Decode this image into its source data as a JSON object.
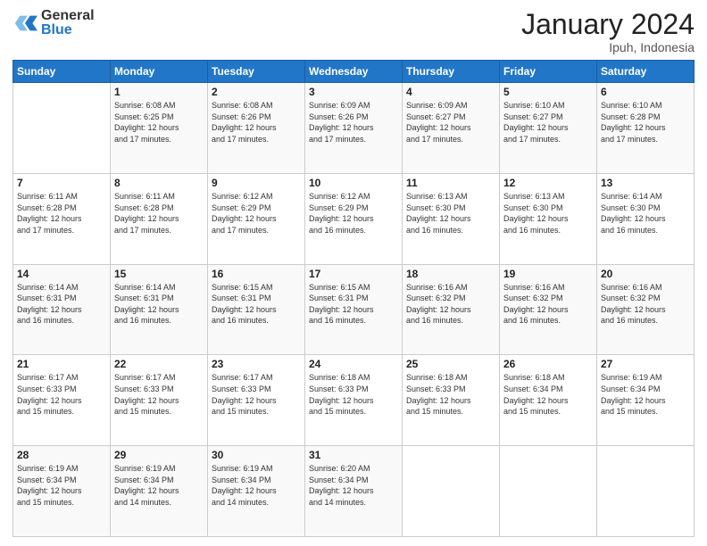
{
  "header": {
    "logo_general": "General",
    "logo_blue": "Blue",
    "month_title": "January 2024",
    "location": "Ipuh, Indonesia"
  },
  "days_of_week": [
    "Sunday",
    "Monday",
    "Tuesday",
    "Wednesday",
    "Thursday",
    "Friday",
    "Saturday"
  ],
  "weeks": [
    [
      {
        "day": "",
        "info": ""
      },
      {
        "day": "1",
        "info": "Sunrise: 6:08 AM\nSunset: 6:25 PM\nDaylight: 12 hours\nand 17 minutes."
      },
      {
        "day": "2",
        "info": "Sunrise: 6:08 AM\nSunset: 6:26 PM\nDaylight: 12 hours\nand 17 minutes."
      },
      {
        "day": "3",
        "info": "Sunrise: 6:09 AM\nSunset: 6:26 PM\nDaylight: 12 hours\nand 17 minutes."
      },
      {
        "day": "4",
        "info": "Sunrise: 6:09 AM\nSunset: 6:27 PM\nDaylight: 12 hours\nand 17 minutes."
      },
      {
        "day": "5",
        "info": "Sunrise: 6:10 AM\nSunset: 6:27 PM\nDaylight: 12 hours\nand 17 minutes."
      },
      {
        "day": "6",
        "info": "Sunrise: 6:10 AM\nSunset: 6:28 PM\nDaylight: 12 hours\nand 17 minutes."
      }
    ],
    [
      {
        "day": "7",
        "info": "Sunrise: 6:11 AM\nSunset: 6:28 PM\nDaylight: 12 hours\nand 17 minutes."
      },
      {
        "day": "8",
        "info": "Sunrise: 6:11 AM\nSunset: 6:28 PM\nDaylight: 12 hours\nand 17 minutes."
      },
      {
        "day": "9",
        "info": "Sunrise: 6:12 AM\nSunset: 6:29 PM\nDaylight: 12 hours\nand 17 minutes."
      },
      {
        "day": "10",
        "info": "Sunrise: 6:12 AM\nSunset: 6:29 PM\nDaylight: 12 hours\nand 16 minutes."
      },
      {
        "day": "11",
        "info": "Sunrise: 6:13 AM\nSunset: 6:30 PM\nDaylight: 12 hours\nand 16 minutes."
      },
      {
        "day": "12",
        "info": "Sunrise: 6:13 AM\nSunset: 6:30 PM\nDaylight: 12 hours\nand 16 minutes."
      },
      {
        "day": "13",
        "info": "Sunrise: 6:14 AM\nSunset: 6:30 PM\nDaylight: 12 hours\nand 16 minutes."
      }
    ],
    [
      {
        "day": "14",
        "info": "Sunrise: 6:14 AM\nSunset: 6:31 PM\nDaylight: 12 hours\nand 16 minutes."
      },
      {
        "day": "15",
        "info": "Sunrise: 6:14 AM\nSunset: 6:31 PM\nDaylight: 12 hours\nand 16 minutes."
      },
      {
        "day": "16",
        "info": "Sunrise: 6:15 AM\nSunset: 6:31 PM\nDaylight: 12 hours\nand 16 minutes."
      },
      {
        "day": "17",
        "info": "Sunrise: 6:15 AM\nSunset: 6:31 PM\nDaylight: 12 hours\nand 16 minutes."
      },
      {
        "day": "18",
        "info": "Sunrise: 6:16 AM\nSunset: 6:32 PM\nDaylight: 12 hours\nand 16 minutes."
      },
      {
        "day": "19",
        "info": "Sunrise: 6:16 AM\nSunset: 6:32 PM\nDaylight: 12 hours\nand 16 minutes."
      },
      {
        "day": "20",
        "info": "Sunrise: 6:16 AM\nSunset: 6:32 PM\nDaylight: 12 hours\nand 16 minutes."
      }
    ],
    [
      {
        "day": "21",
        "info": "Sunrise: 6:17 AM\nSunset: 6:33 PM\nDaylight: 12 hours\nand 15 minutes."
      },
      {
        "day": "22",
        "info": "Sunrise: 6:17 AM\nSunset: 6:33 PM\nDaylight: 12 hours\nand 15 minutes."
      },
      {
        "day": "23",
        "info": "Sunrise: 6:17 AM\nSunset: 6:33 PM\nDaylight: 12 hours\nand 15 minutes."
      },
      {
        "day": "24",
        "info": "Sunrise: 6:18 AM\nSunset: 6:33 PM\nDaylight: 12 hours\nand 15 minutes."
      },
      {
        "day": "25",
        "info": "Sunrise: 6:18 AM\nSunset: 6:33 PM\nDaylight: 12 hours\nand 15 minutes."
      },
      {
        "day": "26",
        "info": "Sunrise: 6:18 AM\nSunset: 6:34 PM\nDaylight: 12 hours\nand 15 minutes."
      },
      {
        "day": "27",
        "info": "Sunrise: 6:19 AM\nSunset: 6:34 PM\nDaylight: 12 hours\nand 15 minutes."
      }
    ],
    [
      {
        "day": "28",
        "info": "Sunrise: 6:19 AM\nSunset: 6:34 PM\nDaylight: 12 hours\nand 15 minutes."
      },
      {
        "day": "29",
        "info": "Sunrise: 6:19 AM\nSunset: 6:34 PM\nDaylight: 12 hours\nand 14 minutes."
      },
      {
        "day": "30",
        "info": "Sunrise: 6:19 AM\nSunset: 6:34 PM\nDaylight: 12 hours\nand 14 minutes."
      },
      {
        "day": "31",
        "info": "Sunrise: 6:20 AM\nSunset: 6:34 PM\nDaylight: 12 hours\nand 14 minutes."
      },
      {
        "day": "",
        "info": ""
      },
      {
        "day": "",
        "info": ""
      },
      {
        "day": "",
        "info": ""
      }
    ]
  ]
}
